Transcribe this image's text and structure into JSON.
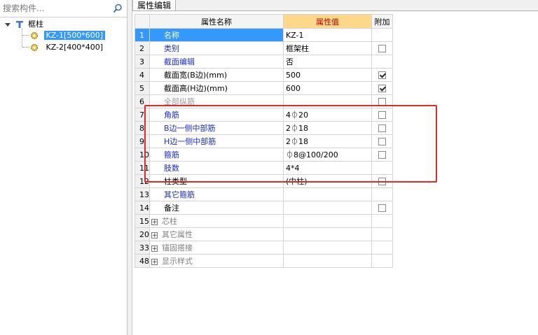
{
  "search": {
    "placeholder": "搜索构件..."
  },
  "tree": {
    "root_label": "框柱",
    "items": [
      {
        "label": "KZ-1[500*600]",
        "selected": true
      },
      {
        "label": "KZ-2[400*400]",
        "selected": false
      }
    ]
  },
  "panel": {
    "tab_label": "属性编辑"
  },
  "grid": {
    "headers": {
      "name": "属性名称",
      "value": "属性值",
      "extra": "附加"
    },
    "rows": [
      {
        "num": "1",
        "name": "名称",
        "value": "KZ-1",
        "checkbox": "none"
      },
      {
        "num": "2",
        "name": "类别",
        "value": "框架柱",
        "checkbox": "unchecked"
      },
      {
        "num": "3",
        "name": "截面编辑",
        "value": "否",
        "checkbox": "none"
      },
      {
        "num": "4",
        "name": "截面宽(B边)(mm)",
        "value": "500",
        "checkbox": "checked"
      },
      {
        "num": "5",
        "name": "截面高(H边)(mm)",
        "value": "600",
        "checkbox": "checked"
      },
      {
        "num": "6",
        "name": "全部纵筋",
        "value": "",
        "checkbox": "unchecked"
      },
      {
        "num": "7",
        "name": "角筋",
        "value": "4⏀20",
        "checkbox": "unchecked"
      },
      {
        "num": "8",
        "name": "B边一侧中部筋",
        "value": "2⏀18",
        "checkbox": "unchecked"
      },
      {
        "num": "9",
        "name": "H边一侧中部筋",
        "value": "2⏀18",
        "checkbox": "unchecked"
      },
      {
        "num": "10",
        "name": "箍筋",
        "value": "⏀8@100/200",
        "checkbox": "unchecked"
      },
      {
        "num": "11",
        "name": "肢数",
        "value": "4*4",
        "checkbox": "none"
      },
      {
        "num": "12",
        "name": "柱类型",
        "value": "(中柱)",
        "checkbox": "unchecked"
      },
      {
        "num": "13",
        "name": "其它箍筋",
        "value": "",
        "checkbox": "none"
      },
      {
        "num": "14",
        "name": "备注",
        "value": "",
        "checkbox": "unchecked"
      }
    ],
    "groups": [
      {
        "num": "15",
        "name": "芯柱"
      },
      {
        "num": "20",
        "name": "其它属性"
      },
      {
        "num": "33",
        "name": "锚固搭接"
      },
      {
        "num": "48",
        "name": "显示样式"
      }
    ]
  },
  "colors": {
    "selection": "#3399ff",
    "header_value_bg": "#fdd88a",
    "annotation": "#e02a2a",
    "link_text": "#1a2dc8"
  }
}
